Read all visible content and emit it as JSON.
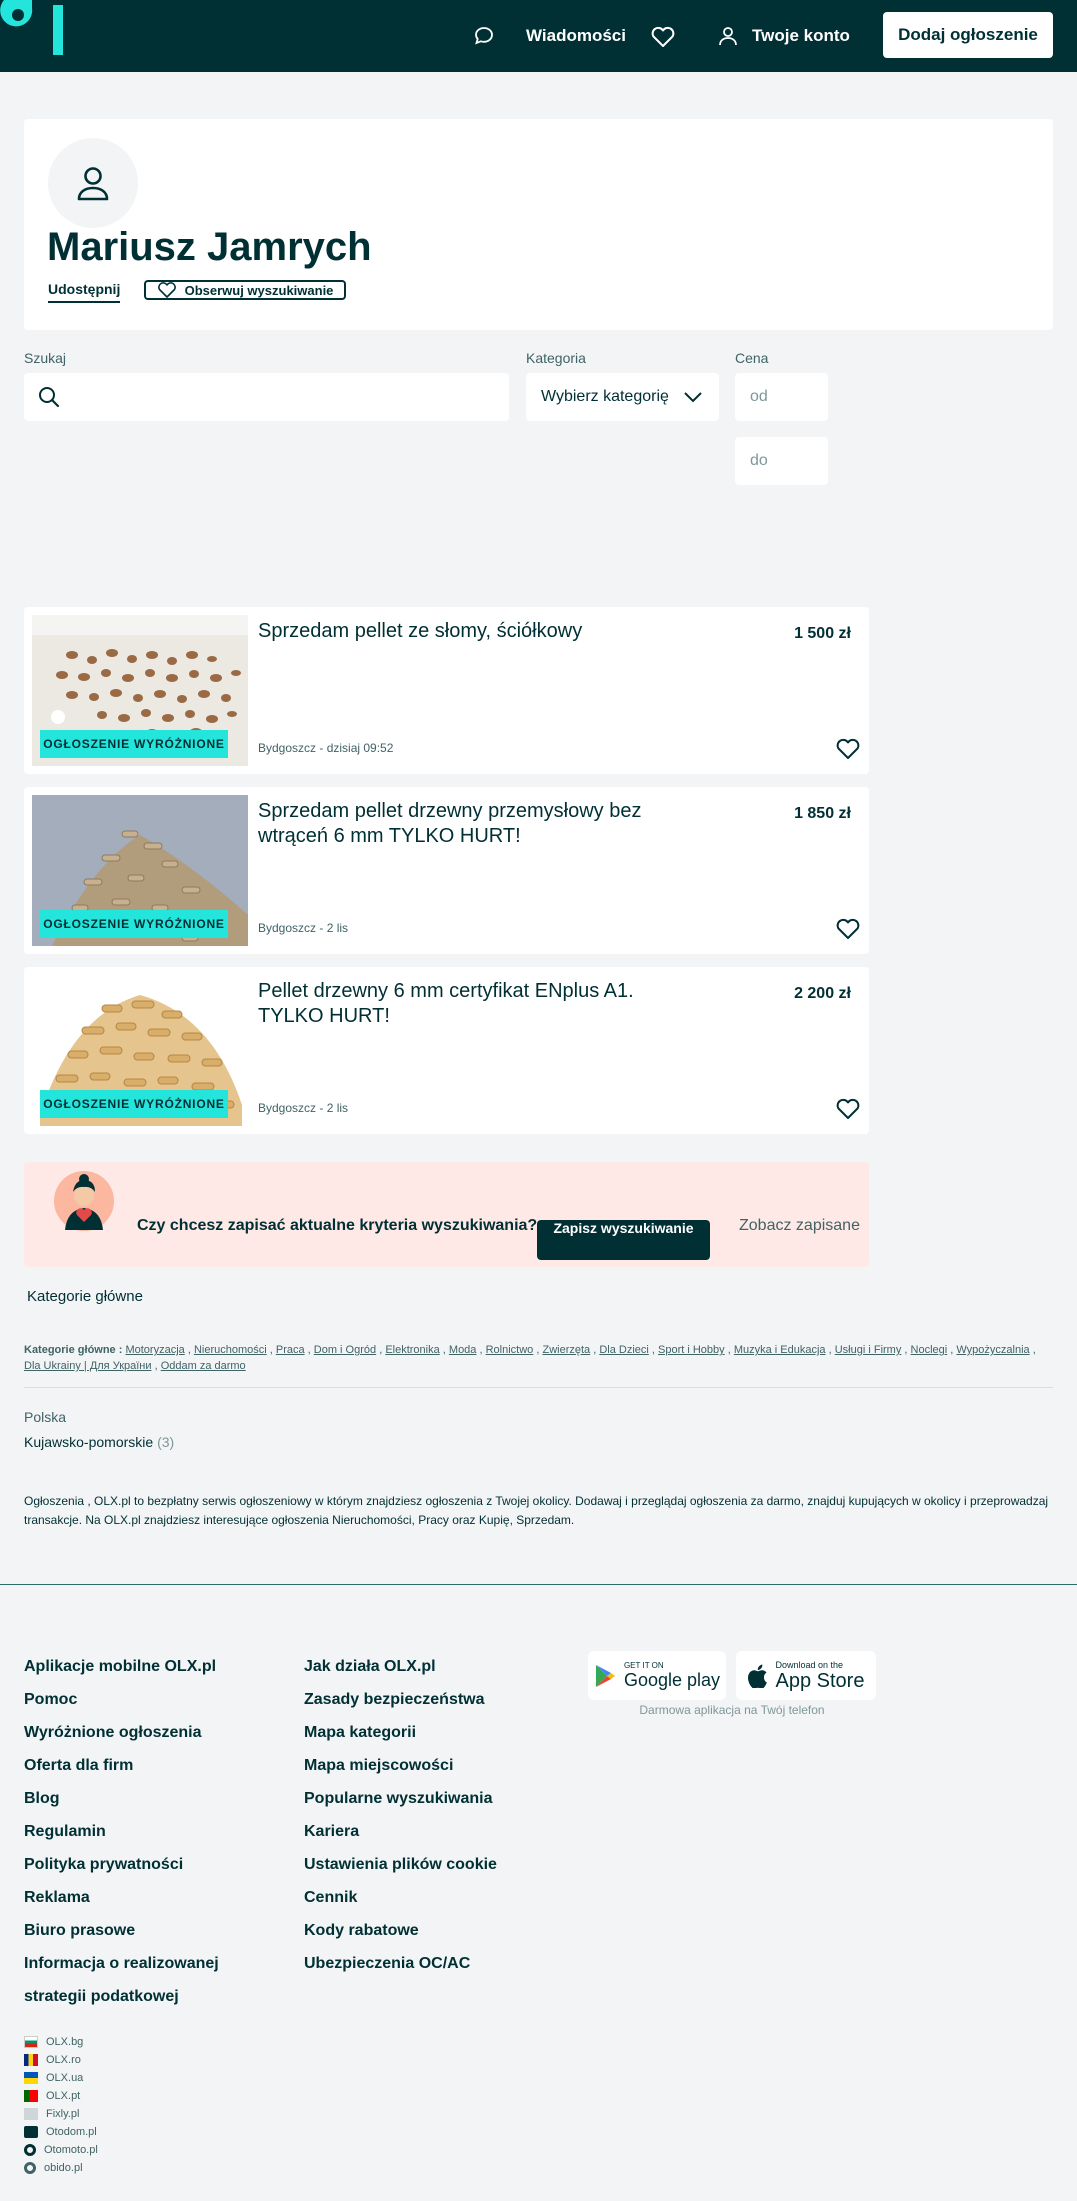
{
  "header": {
    "messages_label": "Wiadomości",
    "account_label": "Twoje konto",
    "add_listing_label": "Dodaj ogłoszenie"
  },
  "profile": {
    "name": "Mariusz Jamrych",
    "share_label": "Udostępnij",
    "follow_label": "Obserwuj wyszukiwanie"
  },
  "filters": {
    "search_label": "Szukaj",
    "category_label": "Kategoria",
    "category_value": "Wybierz kategorię",
    "price_label": "Cena",
    "price_from_placeholder": "od",
    "price_to_placeholder": "do"
  },
  "listings": [
    {
      "title": "Sprzedam pellet ze słomy, ściółkowy",
      "price": "1 500 zł",
      "location": "Bydgoszcz - dzisiaj 09:52",
      "badge": "OGŁOSZENIE WYRÓŻNIONE"
    },
    {
      "title": "Sprzedam pellet drzewny przemysłowy bez wtrąceń 6 mm TYLKO HURT!",
      "price": "1 850 zł",
      "location": "Bydgoszcz - 2 lis",
      "badge": "OGŁOSZENIE WYRÓŻNIONE"
    },
    {
      "title": "Pellet drzewny 6 mm certyfikat ENplus A1. TYLKO HURT!",
      "price": "2 200 zł",
      "location": "Bydgoszcz - 2 lis",
      "badge": "OGŁOSZENIE WYRÓŻNIONE"
    }
  ],
  "saved_search": {
    "question": "Czy chcesz zapisać aktualne kryteria wyszukiwania?",
    "save_button": "Zapisz wyszukiwanie",
    "see_saved": "Zobacz zapisane"
  },
  "main_categories": {
    "title": "Kategorie główne",
    "prefix": "Kategorie główne :",
    "items": [
      "Motoryzacja",
      "Nieruchomości",
      "Praca",
      "Dom i Ogród",
      "Elektronika",
      "Moda",
      "Rolnictwo",
      "Zwierzęta",
      "Dla Dzieci",
      "Sport i Hobby",
      "Muzyka i Edukacja",
      "Usługi i Firmy",
      "Noclegi",
      "Wypożyczalnia",
      "Dla Ukrainy | Для України",
      "Oddam za darmo"
    ]
  },
  "region": {
    "country": "Polska",
    "name": "Kujawsko-pomorskie",
    "count": "(3)"
  },
  "seo_text": "Ogłoszenia , OLX.pl to bezpłatny serwis ogłoszeniowy w którym znajdziesz ogłoszenia z Twojej okolicy. Dodawaj i przeglądaj ogłoszenia za darmo, znajduj kupujących w okolicy i przeprowadzaj transakcje. Na OLX.pl znajdziesz interesujące ogłoszenia Nieruchomości, Pracy oraz Kupię, Sprzedam.",
  "footer": {
    "col1": [
      "Aplikacje mobilne OLX.pl",
      "Pomoc",
      "Wyróżnione ogłoszenia",
      "Oferta dla firm",
      "Blog",
      "Regulamin",
      "Polityka prywatności",
      "Reklama",
      "Biuro prasowe",
      "Informacja o realizowanej strategii podatkowej"
    ],
    "col2": [
      "Jak działa OLX.pl",
      "Zasady bezpieczeństwa",
      "Mapa kategorii",
      "Mapa miejscowości",
      "Popularne wyszukiwania",
      "Kariera",
      "Ustawienia plików cookie",
      "Cennik",
      "Kody rabatowe",
      "Ubezpieczenia OC/AC"
    ],
    "google_play_small": "GET IT ON",
    "google_play_big": "Google play",
    "app_store_small": "Download on the",
    "app_store_big": "App Store",
    "app_caption": "Darmowa aplikacja na Twój telefon",
    "sites": [
      "OLX.bg",
      "OLX.ro",
      "OLX.ua",
      "OLX.pt",
      "Fixly.pl",
      "Otodom.pl",
      "Otomoto.pl",
      "obido.pl"
    ]
  },
  "colors": {
    "brand_dark": "#002f34",
    "accent_teal": "#23e5db",
    "background": "#f2f4f5",
    "banner_pink": "#ffe9e6"
  }
}
